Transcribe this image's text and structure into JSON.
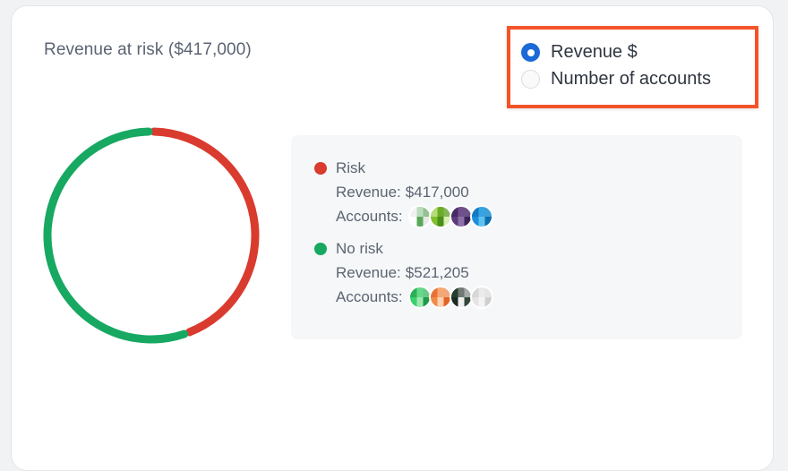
{
  "card": {
    "title": "Revenue at risk ($417,000)"
  },
  "mode": {
    "options": [
      {
        "label": "Revenue $",
        "selected": true
      },
      {
        "label": "Number of accounts",
        "selected": false
      }
    ]
  },
  "donut": {
    "segments": [
      {
        "name": "Risk",
        "value": 417000,
        "color": "#d93b2e"
      },
      {
        "name": "No risk",
        "value": 521205,
        "color": "#17a862"
      }
    ]
  },
  "legend": {
    "revenue_label": "Revenue:",
    "accounts_label": "Accounts:",
    "entries": [
      {
        "name": "Risk",
        "color": "#d93b2e",
        "revenue": "$417,000",
        "avatars": [
          {
            "icon": "account-avatar",
            "colors": [
              "#ffffff",
              "#5aa85a",
              "#e8e8e8"
            ]
          },
          {
            "icon": "account-avatar",
            "colors": [
              "#7fbf2a",
              "#4b8f1e",
              "#d8f0b0"
            ]
          },
          {
            "icon": "account-avatar",
            "colors": [
              "#5b3b7a",
              "#8e70a8",
              "#3a2458"
            ]
          },
          {
            "icon": "account-avatar",
            "colors": [
              "#1b8fd8",
              "#5ec2f0",
              "#0d6eb0"
            ]
          }
        ]
      },
      {
        "name": "No risk",
        "color": "#17a862",
        "revenue": "$521,205",
        "avatars": [
          {
            "icon": "account-avatar",
            "colors": [
              "#3cd06c",
              "#9ee8b0",
              "#1f9a4a"
            ]
          },
          {
            "icon": "account-avatar",
            "colors": [
              "#f28a4a",
              "#ffd2b0",
              "#e06428"
            ]
          },
          {
            "icon": "account-avatar",
            "colors": [
              "#1a2a22",
              "#f0f0f0",
              "#31473b"
            ]
          },
          {
            "icon": "account-avatar",
            "colors": [
              "#e4e4e4",
              "#f4f4f4",
              "#cfcfcf"
            ]
          }
        ]
      }
    ]
  }
}
